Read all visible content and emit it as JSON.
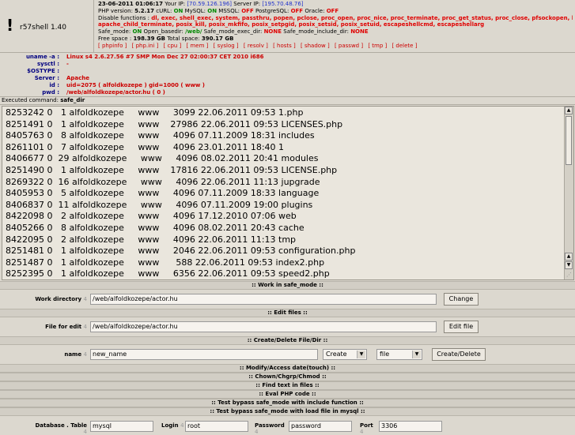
{
  "header": {
    "logo_mark": "!",
    "app_name": "r57shell 1.40",
    "date": "23-06-2011 01:06:17",
    "your_ip_label": "Your IP:",
    "your_ip": "[70.59.126.196]",
    "server_ip_label": "Server IP:",
    "server_ip": "[195.70.48.76]",
    "php_version_label": "PHP version:",
    "php_version": "5.2.17",
    "curl_label": "cURL:",
    "curl": "ON",
    "mysql_label": "MySQL:",
    "mysql": "ON",
    "mssql_label": "MSSQL:",
    "mssql": "OFF",
    "postgresql_label": "PostgreSQL:",
    "postgresql": "OFF",
    "oracle_label": "Oracle:",
    "oracle": "OFF",
    "disable_functions_label": "Disable functions :",
    "disable_functions": "dl, exec, shell_exec, system, passthru, popen, pclose, proc_open, proc_nice, proc_terminate, proc_get_status, proc_close, pfsockopen, leak,",
    "disable_functions_2": "apache_child_terminate, posix_kill, posix_mkfifo, posix_setpgid, posix_setsid, posix_setuid, escapeshellcmd, escapeshellarg",
    "safe_mode_label": "Safe_mode:",
    "safe_mode": "ON",
    "open_basedir_label": "Open_basedir:",
    "open_basedir": "/web/",
    "safe_exec_label": "Safe_mode_exec_dir:",
    "safe_exec": "NONE",
    "safe_include_label": "Safe_mode_include_dir:",
    "safe_include": "NONE",
    "free_space_label": "Free space :",
    "free_space": "198.39 GB",
    "total_space_label": "Total space:",
    "total_space": "390.17 GB",
    "menu": [
      "[ phpinfo ]",
      "[ php.ini ]",
      "[ cpu ]",
      "[ mem ]",
      "[ syslog ]",
      "[ resolv ]",
      "[ hosts ]",
      "[ shadow ]",
      "[ passwd ]",
      "[ tmp ]",
      "[ delete ]"
    ]
  },
  "system": {
    "rows": [
      {
        "label": "uname -a :",
        "value": "Linux s4 2.6.27.56 #7 SMP Mon Dec 27 02:00:37 CET 2010 i686"
      },
      {
        "label": "sysctl :",
        "value": "-"
      },
      {
        "label": "$OSTYPE :",
        "value": ""
      },
      {
        "label": "Server :",
        "value": "Apache"
      },
      {
        "label": "id :",
        "value": "uid=2075 ( alfoldkozepe ) gid=1000 ( www )"
      },
      {
        "label": "pwd :",
        "value": "/web/alfoldkozepe/actor.hu    ( 0 )"
      }
    ]
  },
  "executed": {
    "label": "Executed command:",
    "command": "safe_dir"
  },
  "listing": {
    "rows": [
      "8253242 0   1 alfoldkozepe     www     3099 22.06.2011 09:53 1.php",
      "8251491 0   1 alfoldkozepe     www    27986 22.06.2011 09:53 LICENSES.php",
      "8405763 0   8 alfoldkozepe     www     4096 07.11.2009 18:31 includes",
      "8261101 0   7 alfoldkozepe     www     4096 23.01.2011 18:40 1",
      "8406677 0  29 alfoldkozepe     www     4096 08.02.2011 20:41 modules",
      "8251490 0   1 alfoldkozepe     www    17816 22.06.2011 09:53 LICENSE.php",
      "8269322 0  16 alfoldkozepe     www     4096 22.06.2011 11:13 jupgrade",
      "8405953 0   5 alfoldkozepe     www     4096 07.11.2009 18:33 language",
      "8406837 0  11 alfoldkozepe     www     4096 07.11.2009 19:00 plugins",
      "8422098 0   2 alfoldkozepe     www     4096 17.12.2010 07:06 web",
      "8405266 0   8 alfoldkozepe     www     4096 08.02.2011 20:43 cache",
      "8422095 0   2 alfoldkozepe     www     4096 22.06.2011 11:13 tmp",
      "8251481 0   1 alfoldkozepe     www     2046 22.06.2011 09:53 configuration.php",
      "8251487 0   1 alfoldkozepe     www      588 22.06.2011 09:53 index2.php",
      "8252395 0   1 alfoldkozepe     www     6356 22.06.2011 09:53 speed2.php"
    ]
  },
  "sections": {
    "safe_mode": ":: Work in safe_mode ::",
    "edit_files": ":: Edit files ::",
    "create_delete": ":: Create/Delete File/Dir ::",
    "modify_access": ":: Modify/Access date(touch) ::",
    "chown": ":: Chown/Chgrp/Chmod ::",
    "find_text": ":: Find text in files ::",
    "eval": ":: Eval PHP code ::",
    "bypass_include": ":: Test bypass safe_mode with include function ::",
    "bypass_mysql": ":: Test bypass safe_mode with load file in mysql ::"
  },
  "work_dir": {
    "label": "Work directory",
    "arrow": "4",
    "value": "/web/alfoldkozepe/actor.hu",
    "button": "Change"
  },
  "edit_file": {
    "label": "File for edit",
    "arrow": "4",
    "value": "/web/alfoldkozepe/actor.hu",
    "button": "Edit file"
  },
  "create": {
    "label": "name",
    "arrow": "4",
    "value": "new_name",
    "action": "Create",
    "type": "file",
    "button": "Create/Delete"
  },
  "mysql": {
    "db_label": "Database . Table",
    "db_value": "mysql",
    "login_label": "Login",
    "login_value": "root",
    "password_label": "Password",
    "password_value": "password",
    "port_label": "Port",
    "port_value": "3306",
    "arrow": "4"
  },
  "colors": {
    "bg": "#dcd8cf",
    "accent_red": "#e00000",
    "accent_blue": "#2233cc",
    "accent_green": "#008800"
  }
}
